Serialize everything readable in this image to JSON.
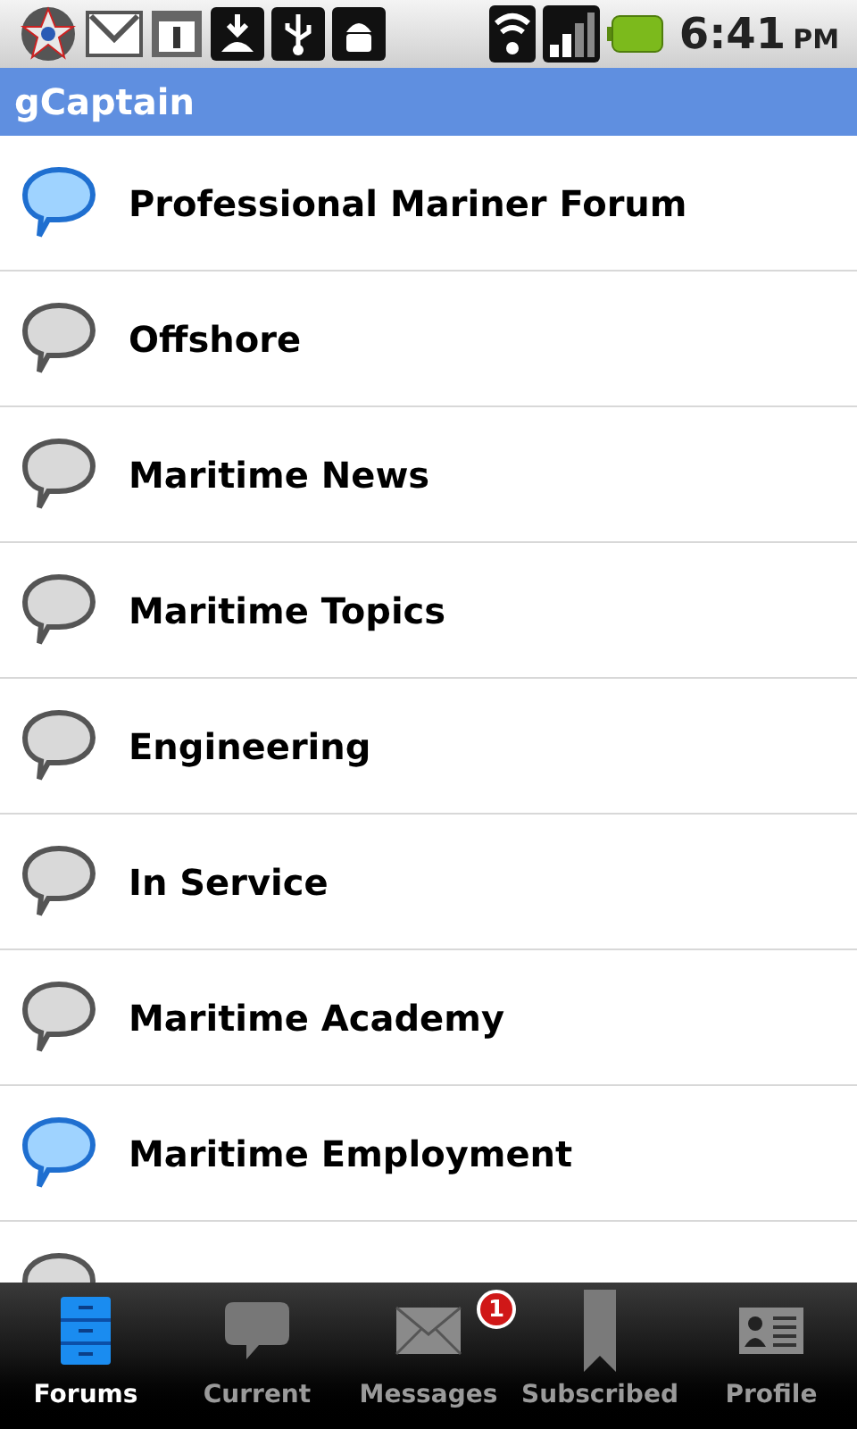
{
  "status_bar": {
    "time": "6:41",
    "meridiem": "PM"
  },
  "title_bar": {
    "title": "gCaptain"
  },
  "forums": [
    {
      "title": "Professional Mariner Forum",
      "unread": true
    },
    {
      "title": "Offshore",
      "unread": false
    },
    {
      "title": "Maritime News",
      "unread": false
    },
    {
      "title": "Maritime Topics",
      "unread": false
    },
    {
      "title": "Engineering",
      "unread": false
    },
    {
      "title": "In Service",
      "unread": false
    },
    {
      "title": "Maritime Academy",
      "unread": false
    },
    {
      "title": "Maritime Employment",
      "unread": true
    },
    {
      "unread": false
    }
  ],
  "tabs": [
    {
      "label": "Forums",
      "kind": "forums",
      "selected": true
    },
    {
      "label": "Current",
      "kind": "current",
      "selected": false
    },
    {
      "label": "Messages",
      "kind": "messages",
      "selected": false,
      "badge": "1"
    },
    {
      "label": "Subscribed",
      "kind": "subscribed",
      "selected": false
    },
    {
      "label": "Profile",
      "kind": "profile",
      "selected": false
    }
  ]
}
